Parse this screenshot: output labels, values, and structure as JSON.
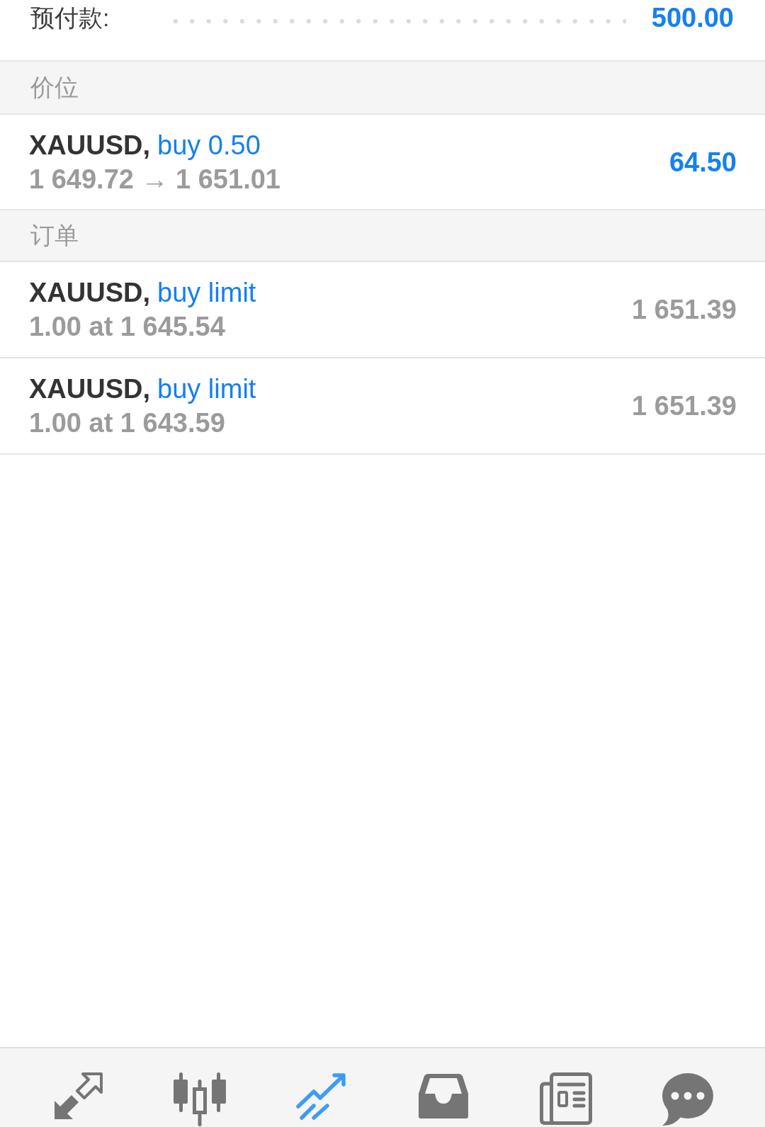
{
  "summary_row": {
    "label": "预付款:",
    "value": "500.00"
  },
  "sections": [
    {
      "title": "价位",
      "items": [
        {
          "kind": "position",
          "symbol": "XAUUSD,",
          "type": "buy 0.50",
          "detail": "1 649.72 → 1 651.01",
          "value": "64.50"
        }
      ]
    },
    {
      "title": "订单",
      "items": [
        {
          "kind": "order",
          "symbol": "XAUUSD,",
          "type": "buy limit",
          "detail": "1.00 at 1 645.54",
          "value": "1 651.39"
        },
        {
          "kind": "order",
          "symbol": "XAUUSD,",
          "type": "buy limit",
          "detail": "1.00 at 1 643.59",
          "value": "1 651.39"
        }
      ]
    }
  ],
  "bottom_nav": [
    {
      "selected": false
    },
    {
      "selected": false
    },
    {
      "selected": true
    },
    {
      "selected": false
    },
    {
      "selected": false
    },
    {
      "selected": false
    }
  ]
}
